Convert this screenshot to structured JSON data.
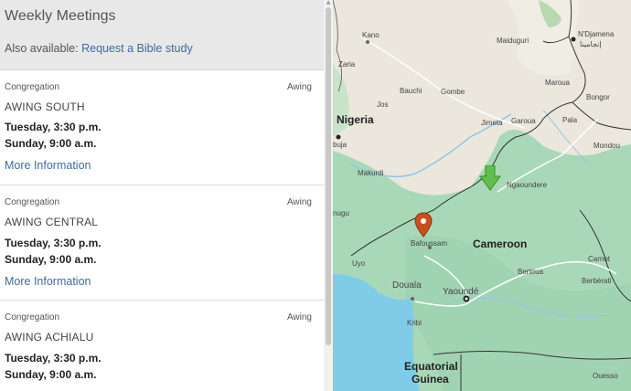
{
  "header": {
    "title": "Weekly Meetings",
    "also_prefix": "Also available:",
    "also_link": "Request a Bible study"
  },
  "cards": [
    {
      "type": "Congregation",
      "language": "Awing",
      "name": "AWING SOUTH",
      "time1": "Tuesday, 3:30 p.m.",
      "time2": "Sunday, 9:00 a.m.",
      "more": "More Information"
    },
    {
      "type": "Congregation",
      "language": "Awing",
      "name": "AWING CENTRAL",
      "time1": "Tuesday, 3:30 p.m.",
      "time2": "Sunday, 9:00 a.m.",
      "more": "More Information"
    },
    {
      "type": "Congregation",
      "language": "Awing",
      "name": "AWING ACHIALU",
      "time1": "Tuesday, 3:30 p.m.",
      "time2": "Sunday, 9:00 a.m."
    }
  ],
  "map": {
    "labels": {
      "kano": "Kano",
      "maiduguri": "Maiduguri",
      "ndjamena": "N'Djamena",
      "ndjamena_ar": "إنجامينا",
      "zaria": "Zaria",
      "maroua": "Maroua",
      "bongor": "Bongor",
      "bauchi": "Bauchi",
      "gombe": "Gombe",
      "nigeria": "Nigeria",
      "jos": "Jos",
      "jimeta": "Jimeta",
      "garoua": "Garoua",
      "pala": "Pala",
      "abuja": "buja",
      "mondou": "Mondou",
      "makurdi": "Makurdi",
      "ngaoundere": "Ngaoundere",
      "nugu": "nugu",
      "bafoussam": "Bafoussam",
      "cameroon": "Cameroon",
      "carnot": "Carnot",
      "uyo": "Uyo",
      "bertoua": "Bertoua",
      "berberati": "Berbérati",
      "douala": "Douala",
      "yaounde": "Yaoundé",
      "kribi": "Kribi",
      "eq_guinea_1": "Equatorial",
      "eq_guinea_2": "Guinea",
      "ouesso": "Ouesso"
    },
    "colors": {
      "land": "#eae6dc",
      "green": "#a9d8b8",
      "water": "#7fcbe8",
      "pin": "#c8501e",
      "arrow": "#5fc04a"
    }
  }
}
